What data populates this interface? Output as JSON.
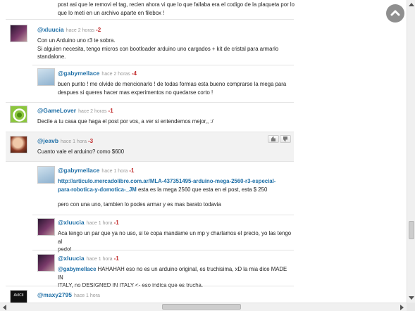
{
  "top_fragment": {
    "line1": "post asi que le removi el tag, recien ahora vi que lo que fallaba era el codigo de la plaqueta por lo",
    "line2": "que lo meti en un archivo aparte en filebox !"
  },
  "comments": [
    {
      "user": "@xluucia",
      "ago": "hace 2 horas",
      "votes": "-2",
      "lines": [
        "Con un Arduino uno r3 te sobra.",
        "Si alguien necesita, tengo micros con bootloader arduino uno cargados + kit de cristal para armarlo",
        "standalone."
      ]
    },
    {
      "user": "@gabymellace",
      "ago": "hace 2 horas",
      "votes": "-4",
      "lines": [
        "buen punto ! me olvide de mencionarlo ! de todas formas esta bueno comprarse la mega para",
        "despues si queres hacer mas experimentos no quedarse corto !"
      ]
    },
    {
      "user": "@GameLover",
      "ago": "hace 2 horas",
      "votes": "-1",
      "lines": [
        "Decile a tu casa que haga el post por vos, a ver si entendemos mejor,, :/"
      ]
    },
    {
      "user": "@jeavb",
      "ago": "hace 1 hora",
      "votes": "-3",
      "lines": [
        "Cuanto vale el arduino? como $600"
      ]
    },
    {
      "user": "@gabymellace",
      "ago": "hace 1 hora",
      "votes": "-1",
      "link_line1": "http://articulo.mercadolibre.com.ar/MLA-437351495-arduino-mega-2560-r3-especial-",
      "link_line2": "para-robotica-y-domotica-_JM",
      "after_link": " esta es la mega 2560 que esta en el post, esta $ 250",
      "extra": "pero con una uno, tambien lo podes armar y es mas barato todavia"
    },
    {
      "user": "@xluucia",
      "ago": "hace 1 hora",
      "votes": "-1",
      "lines": [
        "Aca tengo un par que ya no uso, si te copa mandame un mp y charlamos el precio, yo las tengo al",
        "pedo!"
      ]
    },
    {
      "user": "@xluucia",
      "ago": "hace 1 hora",
      "votes": "-1",
      "mention": "@gabymellace",
      "line1_rest": " HAHAHAH eso no es un arduino original, es truchisima, xD la mia dice MADE IN",
      "line2": "ITALY, no DESIGNED IN ITALY <- eso indica que es trucha."
    },
    {
      "user": "@maxy2795",
      "ago": "hace 1 hora",
      "votes": ""
    }
  ],
  "avatars": {
    "gamelover_colors": [
      "#8cc63f",
      "#4d8f12"
    ],
    "maxy_label": "AVICII"
  },
  "icons": {
    "scroll_top": "chevron-up-icon",
    "like": "thumb-up-icon",
    "dislike": "thumb-down-icon"
  }
}
